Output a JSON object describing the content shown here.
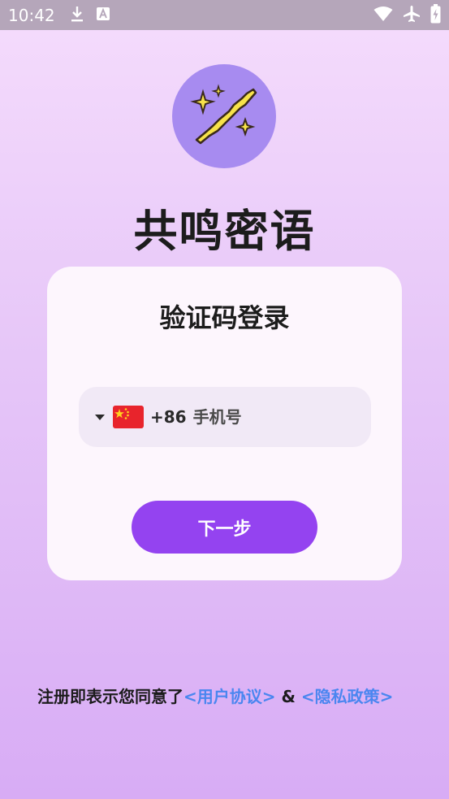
{
  "status_bar": {
    "time": "10:42",
    "left_icons": [
      "download-icon",
      "font-a-icon"
    ],
    "right_icons": [
      "wifi-icon",
      "airplane-mode-icon",
      "battery-charging-icon"
    ]
  },
  "app": {
    "logo_icon": "magic-wand-icon",
    "title": "共鸣密语"
  },
  "login_card": {
    "title": "验证码登录",
    "country_flag": "china-flag-icon",
    "dial_code": "+86",
    "phone_placeholder": "手机号",
    "phone_value": "",
    "next_label": "下一步"
  },
  "agreement": {
    "prefix": "注册即表示您同意了",
    "user_agreement": "<用户协议>",
    "separator": " & ",
    "privacy_policy": "<隐私政策>"
  },
  "colors": {
    "accent": "#9443f0",
    "logo_bg": "#a78bf0",
    "link": "#4a86f0",
    "card_bg": "#fdf6fd",
    "status_bar_bg": "#b5a6ba"
  }
}
